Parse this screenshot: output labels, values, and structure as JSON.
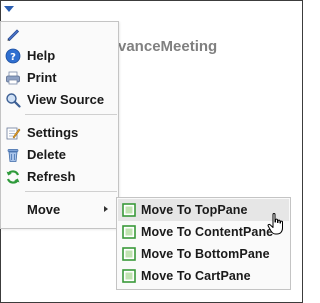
{
  "background": {
    "title_fragment": "vanceMeeting"
  },
  "menu": {
    "items": [
      {
        "label": "",
        "icon": "pencil-icon"
      },
      {
        "label": "Help",
        "icon": "help-icon"
      },
      {
        "label": "Print",
        "icon": "print-icon"
      },
      {
        "label": "View Source",
        "icon": "view-source-icon"
      },
      {
        "label": "Settings",
        "icon": "settings-icon"
      },
      {
        "label": "Delete",
        "icon": "delete-icon"
      },
      {
        "label": "Refresh",
        "icon": "refresh-icon"
      },
      {
        "label": "Move",
        "icon": "chevron-right-icon"
      }
    ]
  },
  "submenu": {
    "items": [
      {
        "label": "Move To TopPane",
        "icon": "pane-icon",
        "highlighted": true
      },
      {
        "label": "Move To ContentPane",
        "icon": "pane-icon",
        "highlighted": false
      },
      {
        "label": "Move To BottomPane",
        "icon": "pane-icon",
        "highlighted": false
      },
      {
        "label": "Move To CartPane",
        "icon": "pane-icon",
        "highlighted": false
      }
    ]
  },
  "colors": {
    "accent_blue": "#2a5db0",
    "pane_icon_green": "#3a9a3a",
    "hover_background": "#e6e6e6"
  }
}
